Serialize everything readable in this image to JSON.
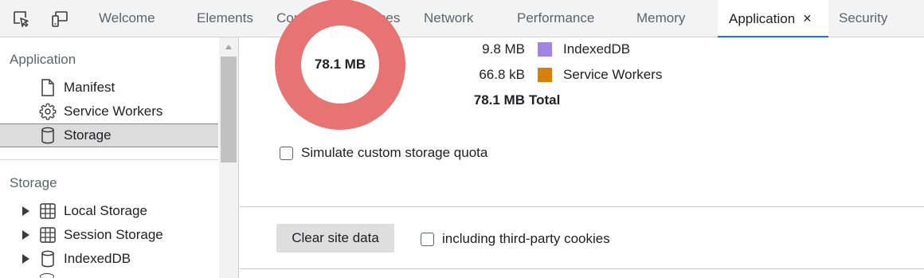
{
  "toolbar": {
    "inspect_icon": "inspect-element-icon",
    "device_icon": "device-emulation-icon"
  },
  "tabs": [
    {
      "label": "Welcome"
    },
    {
      "label": "Elements"
    },
    {
      "label": "Console"
    },
    {
      "label": "Sources"
    },
    {
      "label": "Network"
    },
    {
      "label": "Performance"
    },
    {
      "label": "Memory"
    },
    {
      "label": "Application",
      "active": true,
      "close": "×"
    },
    {
      "label": "Security"
    }
  ],
  "sidebar": {
    "application_title": "Application",
    "application_items": [
      {
        "label": "Manifest",
        "icon": "document-icon"
      },
      {
        "label": "Service Workers",
        "icon": "gear-icon"
      },
      {
        "label": "Storage",
        "icon": "database-icon",
        "selected": true
      }
    ],
    "storage_title": "Storage",
    "storage_items": [
      {
        "label": "Local Storage",
        "icon": "table-icon"
      },
      {
        "label": "Session Storage",
        "icon": "table-icon"
      },
      {
        "label": "IndexedDB",
        "icon": "database-icon"
      }
    ]
  },
  "usage": {
    "donut_label": "78.1 MB",
    "donut_color": "#e87373",
    "legend": [
      {
        "size": "9.8 MB",
        "name": "IndexedDB",
        "color": "#a186e6"
      },
      {
        "size": "66.8 kB",
        "name": "Service Workers",
        "color": "#d4820b"
      },
      {
        "size": "78.1 MB",
        "name": "Total",
        "total": true
      }
    ],
    "simulate_quota_label": "Simulate custom storage quota"
  },
  "clear": {
    "button_label": "Clear site data",
    "third_party_label": "including third-party cookies"
  }
}
